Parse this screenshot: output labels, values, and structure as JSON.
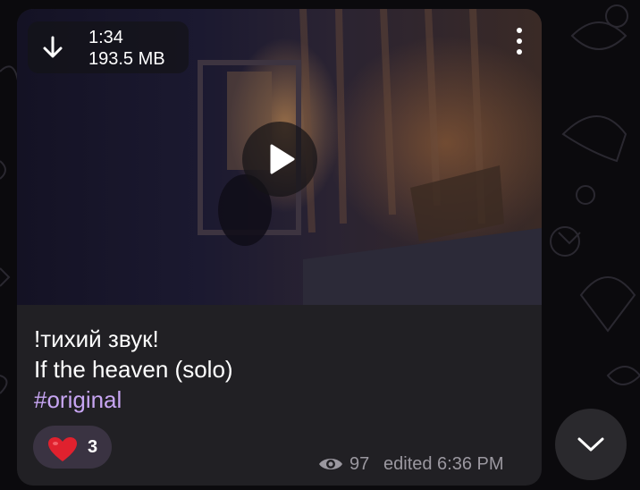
{
  "video": {
    "duration": "1:34",
    "file_size": "193.5 MB"
  },
  "caption": {
    "line1": "!тихий звук!",
    "line2": "If the heaven (solo)",
    "hashtag": "#original"
  },
  "reaction": {
    "emoji": "heart",
    "count": "3"
  },
  "meta": {
    "views": "97",
    "edited_time": "edited 6:36 PM"
  },
  "colors": {
    "bubble": "#212024",
    "hashtag": "#c7a5f2",
    "reaction_bg": "#3a3342",
    "heart": "#e0212e",
    "meta_text": "#9b98a0",
    "background": "#0b0a0d"
  }
}
